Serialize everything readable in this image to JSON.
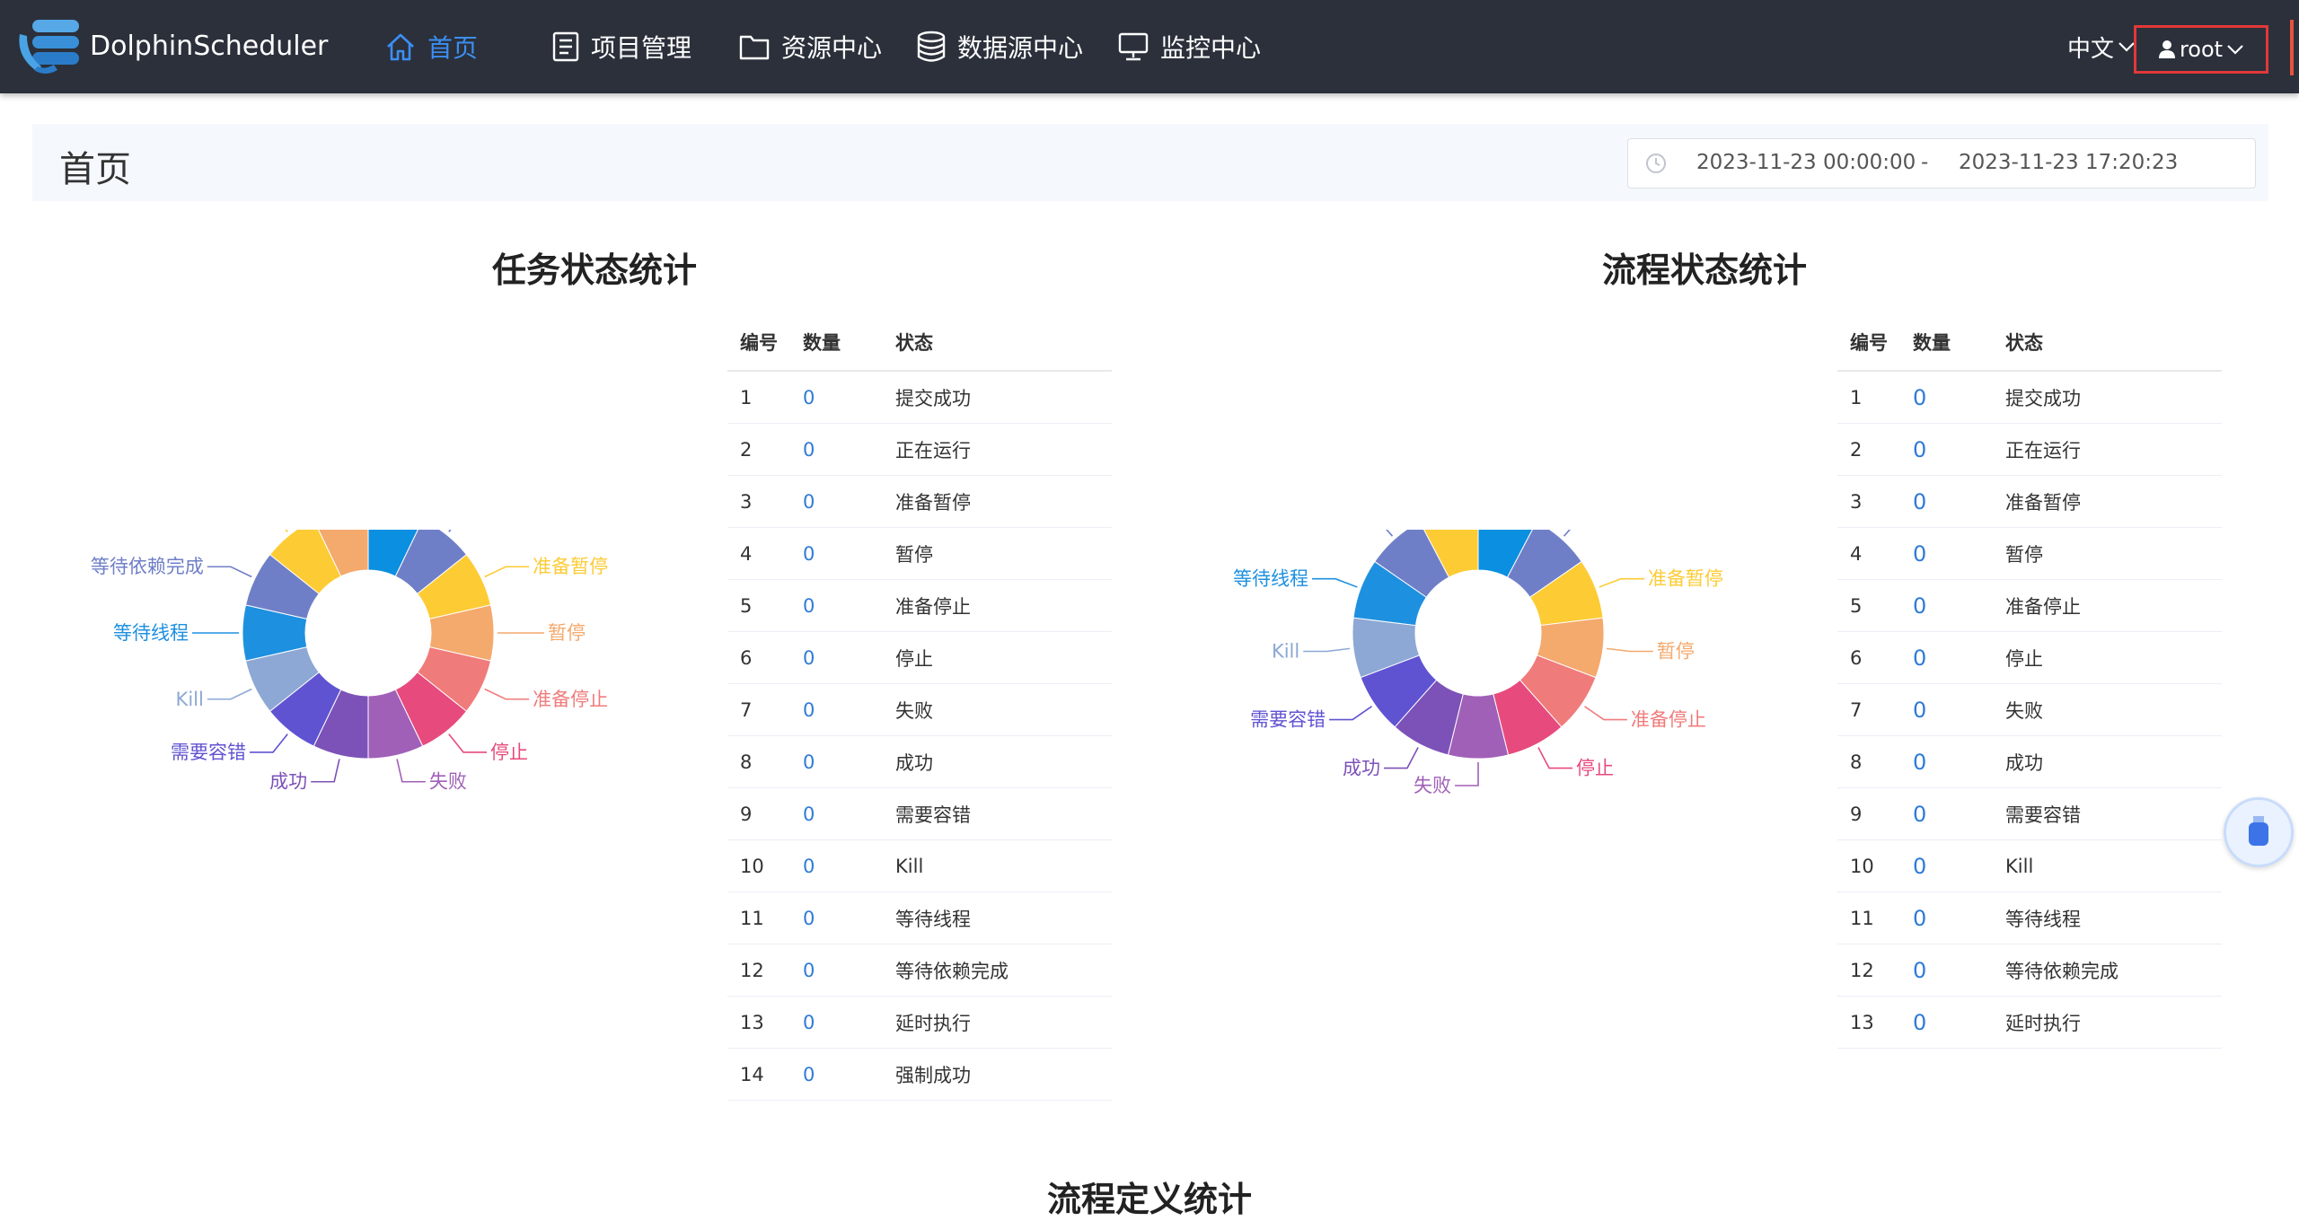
{
  "app": {
    "brand": "DolphinScheduler"
  },
  "nav": {
    "home": "首页",
    "projects": "项目管理",
    "resources": "资源中心",
    "datasource": "数据源中心",
    "monitor": "监控中心",
    "language": "中文",
    "user": "root"
  },
  "page": {
    "title": "首页",
    "date_start": "2023-11-23 00:00:00",
    "date_sep": "-",
    "date_end": "2023-11-23 17:20:23"
  },
  "task_stats": {
    "title": "任务状态统计",
    "columns": [
      "编号",
      "数量",
      "状态"
    ],
    "rows": [
      [
        "1",
        "0",
        "提交成功"
      ],
      [
        "2",
        "0",
        "正在运行"
      ],
      [
        "3",
        "0",
        "准备暂停"
      ],
      [
        "4",
        "0",
        "暂停"
      ],
      [
        "5",
        "0",
        "准备停止"
      ],
      [
        "6",
        "0",
        "停止"
      ],
      [
        "7",
        "0",
        "失败"
      ],
      [
        "8",
        "0",
        "成功"
      ],
      [
        "9",
        "0",
        "需要容错"
      ],
      [
        "10",
        "0",
        "Kill"
      ],
      [
        "11",
        "0",
        "等待线程"
      ],
      [
        "12",
        "0",
        "等待依赖完成"
      ],
      [
        "13",
        "0",
        "延时执行"
      ],
      [
        "14",
        "0",
        "强制成功"
      ]
    ]
  },
  "process_stats": {
    "title": "流程状态统计",
    "columns": [
      "编号",
      "数量",
      "状态"
    ],
    "rows": [
      [
        "1",
        "0",
        "提交成功"
      ],
      [
        "2",
        "0",
        "正在运行"
      ],
      [
        "3",
        "0",
        "准备暂停"
      ],
      [
        "4",
        "0",
        "暂停"
      ],
      [
        "5",
        "0",
        "准备停止"
      ],
      [
        "6",
        "0",
        "停止"
      ],
      [
        "7",
        "0",
        "失败"
      ],
      [
        "8",
        "0",
        "成功"
      ],
      [
        "9",
        "0",
        "需要容错"
      ],
      [
        "10",
        "0",
        "Kill"
      ],
      [
        "11",
        "0",
        "等待线程"
      ],
      [
        "12",
        "0",
        "等待依赖完成"
      ],
      [
        "13",
        "0",
        "延时执行"
      ]
    ]
  },
  "chart_data": [
    {
      "type": "pie",
      "title": "任务状态统计",
      "categories": [
        "提交成功",
        "正在运行",
        "准备暂停",
        "暂停",
        "准备停止",
        "停止",
        "失败",
        "成功",
        "需要容错",
        "Kill",
        "等待线程",
        "等待依赖完成",
        "延时执行",
        "强制成功"
      ],
      "values": [
        0,
        0,
        0,
        0,
        0,
        0,
        0,
        0,
        0,
        0,
        0,
        0,
        0,
        0
      ],
      "colors": [
        "#0b8fe0",
        "#6f7fc7",
        "#fdcb34",
        "#f4a96d",
        "#f07b7b",
        "#e74a7c",
        "#a060b8",
        "#7c52b8",
        "#6053d2",
        "#8da8d4",
        "#1e90e0",
        "#6f7fc7",
        "#fdcb34",
        "#f4a96d"
      ]
    },
    {
      "type": "pie",
      "title": "流程状态统计",
      "categories": [
        "提交成功",
        "正在运行",
        "准备暂停",
        "暂停",
        "准备停止",
        "停止",
        "失败",
        "成功",
        "需要容错",
        "Kill",
        "等待线程",
        "等待依赖完成",
        "延时执行"
      ],
      "values": [
        0,
        0,
        0,
        0,
        0,
        0,
        0,
        0,
        0,
        0,
        0,
        0,
        0
      ],
      "colors": [
        "#0b8fe0",
        "#6f7fc7",
        "#fdcb34",
        "#f4a96d",
        "#f07b7b",
        "#e74a7c",
        "#a060b8",
        "#7c52b8",
        "#6053d2",
        "#8da8d4",
        "#1e90e0",
        "#6f7fc7",
        "#fdcb34"
      ]
    }
  ],
  "definition_stats": {
    "title": "流程定义统计"
  }
}
